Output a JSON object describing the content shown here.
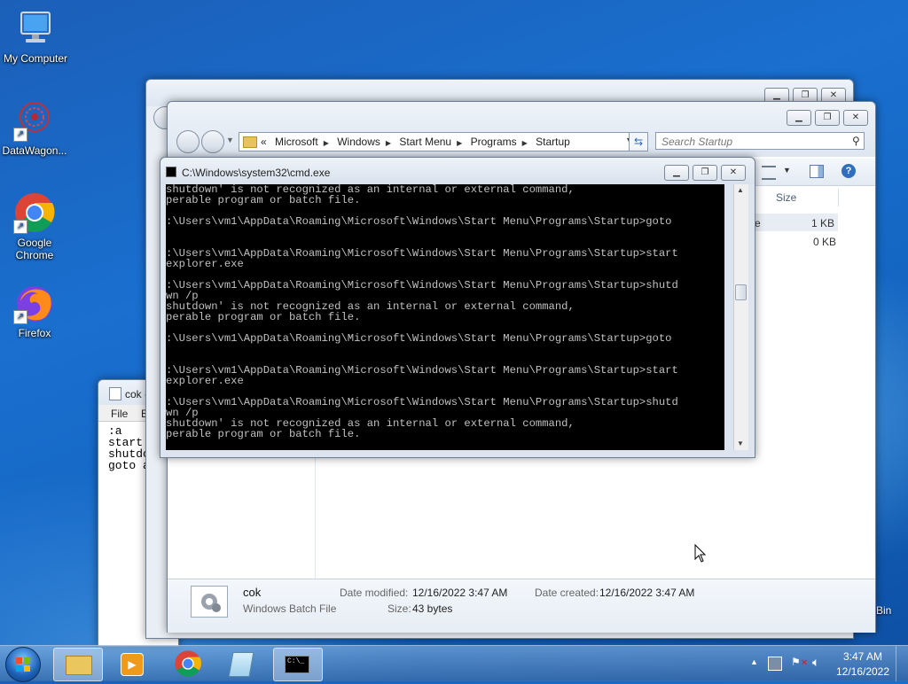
{
  "desktop": {
    "icons": [
      {
        "label": "My Computer"
      },
      {
        "label": "DataWagon..."
      },
      {
        "label": "Google Chrome"
      },
      {
        "label": "Firefox"
      }
    ],
    "recycle_label": "Bin"
  },
  "notepad": {
    "title": "cok - N",
    "menu": [
      "File",
      "Edi"
    ],
    "lines": [
      ":a",
      "start e",
      "shutdow",
      "goto a"
    ]
  },
  "explorer": {
    "breadcrumb": [
      "Microsoft",
      "Windows",
      "Start Menu",
      "Programs",
      "Startup"
    ],
    "breadcrumb_prefix": "«",
    "search_placeholder": "Search Startup",
    "column_size": "Size",
    "sizes": [
      "1 KB",
      "0 KB"
    ],
    "row_fragment": "e",
    "details": {
      "name": "cok",
      "type": "Windows Batch File",
      "date_modified_label": "Date modified:",
      "date_modified": "12/16/2022 3:47 AM",
      "date_created_label": "Date created:",
      "date_created": "12/16/2022 3:47 AM",
      "size_label": "Size:",
      "size": "43 bytes"
    }
  },
  "cmd": {
    "title": "C:\\Windows\\system32\\cmd.exe",
    "lines": [
      "shutdown' is not recognized as an internal or external command,",
      "perable program or batch file.",
      "",
      ":\\Users\\vm1\\AppData\\Roaming\\Microsoft\\Windows\\Start Menu\\Programs\\Startup>goto",
      "",
      "",
      ":\\Users\\vm1\\AppData\\Roaming\\Microsoft\\Windows\\Start Menu\\Programs\\Startup>start",
      "explorer.exe",
      "",
      ":\\Users\\vm1\\AppData\\Roaming\\Microsoft\\Windows\\Start Menu\\Programs\\Startup>shutd",
      "wn /p",
      "shutdown' is not recognized as an internal or external command,",
      "perable program or batch file.",
      "",
      ":\\Users\\vm1\\AppData\\Roaming\\Microsoft\\Windows\\Start Menu\\Programs\\Startup>goto",
      "",
      "",
      ":\\Users\\vm1\\AppData\\Roaming\\Microsoft\\Windows\\Start Menu\\Programs\\Startup>start",
      "explorer.exe",
      "",
      ":\\Users\\vm1\\AppData\\Roaming\\Microsoft\\Windows\\Start Menu\\Programs\\Startup>shutd",
      "wn /p",
      "shutdown' is not recognized as an internal or external command,",
      "perable program or batch file."
    ],
    "left_edge_chars": [
      "C",
      "",
      "",
      "",
      "",
      "",
      "",
      "",
      "",
      "",
      "",
      "",
      "",
      "",
      "",
      "",
      "",
      "",
      "",
      "",
      "",
      "",
      "",
      "",
      ""
    ]
  },
  "taskbar": {
    "clock_time": "3:47 AM",
    "clock_date": "12/16/2022",
    "cmd_icon_text": "C:\\_"
  },
  "colors": {
    "accent": "#1a6fcf",
    "cmd_bg": "#000000",
    "cmd_text": "#c0c0c0"
  }
}
